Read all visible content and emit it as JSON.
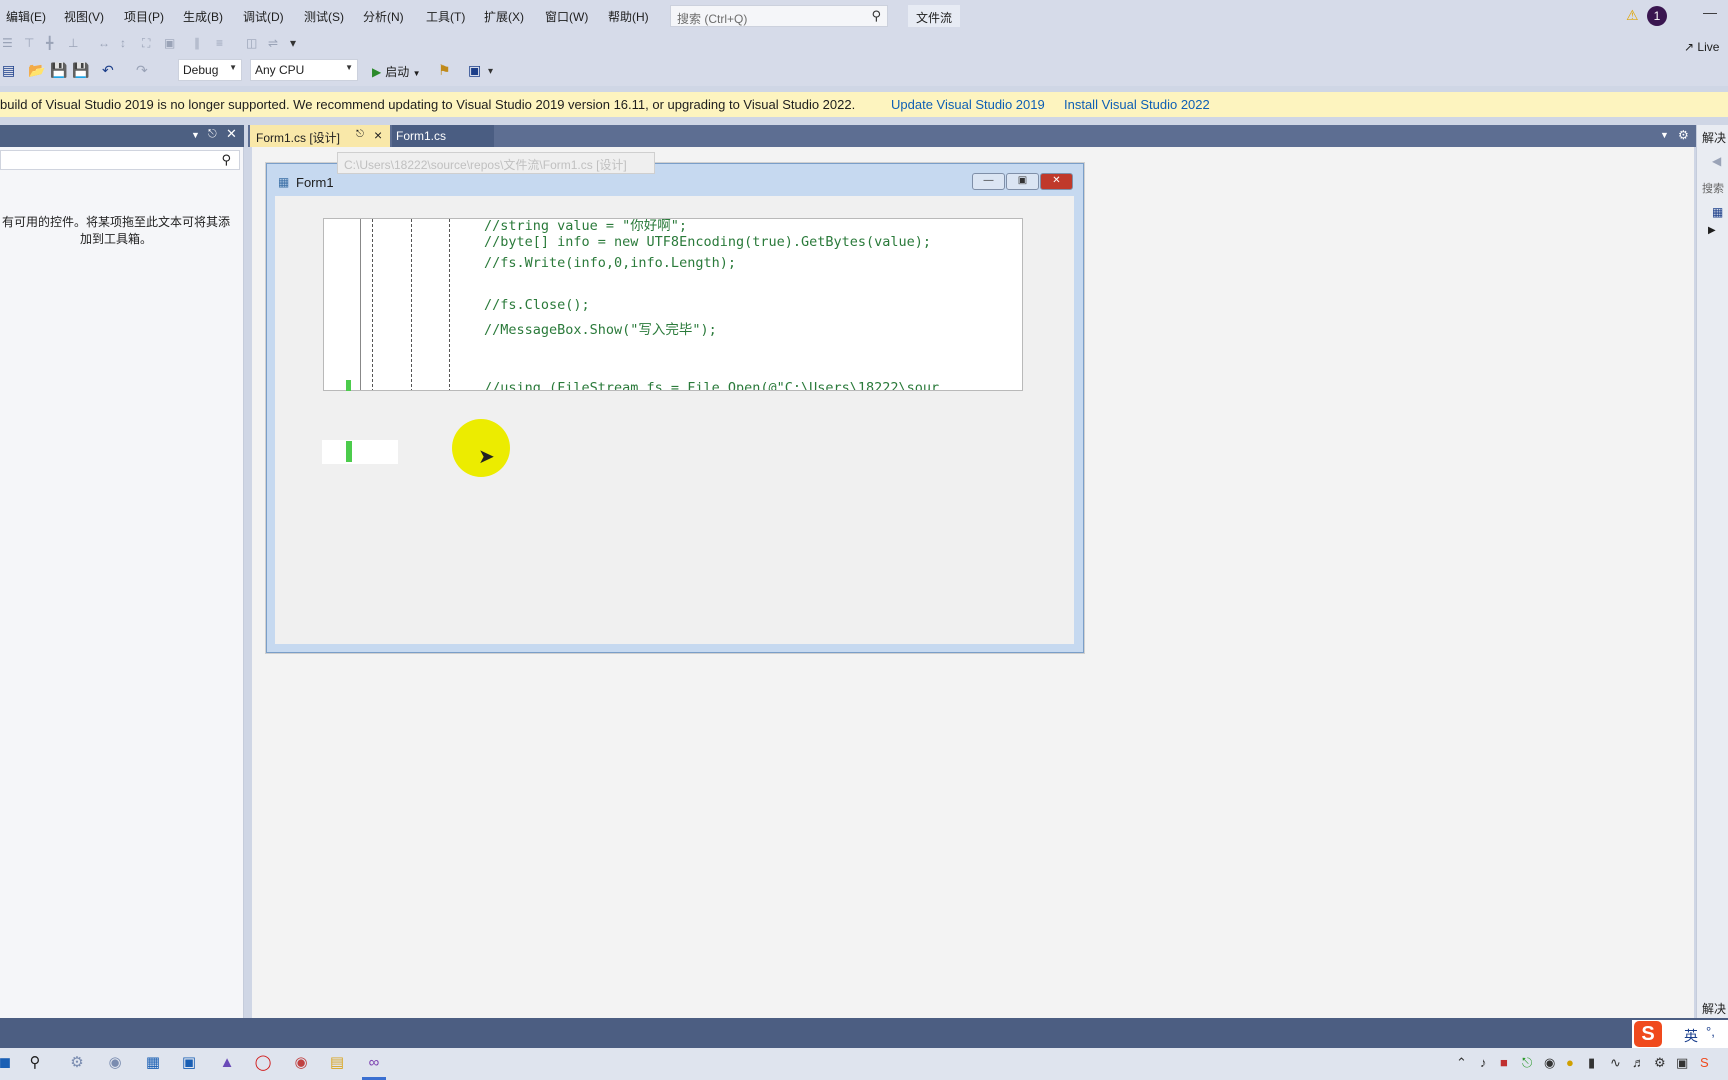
{
  "menu": {
    "items": [
      "编辑(E)",
      "视图(V)",
      "项目(P)",
      "生成(B)",
      "调试(D)",
      "测试(S)",
      "分析(N)",
      "工具(T)",
      "扩展(X)",
      "窗口(W)",
      "帮助(H)"
    ],
    "search_placeholder": "搜索 (Ctrl+Q)",
    "solution_name": "文件流",
    "account_initial": "1"
  },
  "toolbar": {
    "config": "Debug",
    "platform": "Any CPU",
    "start_label": "启动",
    "liveshare_label": "Live"
  },
  "infobar": {
    "message": "build of Visual Studio 2019 is no longer supported. We recommend updating to Visual Studio 2019 version 16.11, or upgrading to Visual Studio 2022.",
    "link_update": "Update Visual Studio 2019",
    "link_install": "Install Visual Studio 2022"
  },
  "toolbox": {
    "empty_message": "有可用的控件。将某项拖至此文本可将其添加到工具箱。"
  },
  "tabs": {
    "design_tab": "Form1.cs [设计]",
    "code_tab": "Form1.cs",
    "tooltip_path": "C:\\Users\\18222\\source\\repos\\文件流\\Form1.cs [设计]"
  },
  "form": {
    "title": "Form1",
    "code_lines": [
      "//string value = \"你好啊\";",
      "//byte[] info = new UTF8Encoding(true).GetBytes(value);",
      "//fs.Write(info,0,info.Length);",
      "",
      "//fs.Close();",
      "//MessageBox.Show(\"写入完毕\");",
      "",
      "",
      "//using (FileStream fs = File.Open(@\"C:\\Users\\18222\\sour"
    ]
  },
  "solution_explorer": {
    "title": "解决",
    "search": "搜索",
    "bottom": "解决"
  },
  "ime": {
    "lang": "英"
  },
  "colors": {
    "menubar": "#d6dbe9",
    "infobar": "#fdf4bf",
    "active_tab": "#f9e8a9",
    "statusbar": "#4c5e82",
    "cursor_highlight": "#ecec00",
    "code_comment": "#2a7a3a"
  }
}
